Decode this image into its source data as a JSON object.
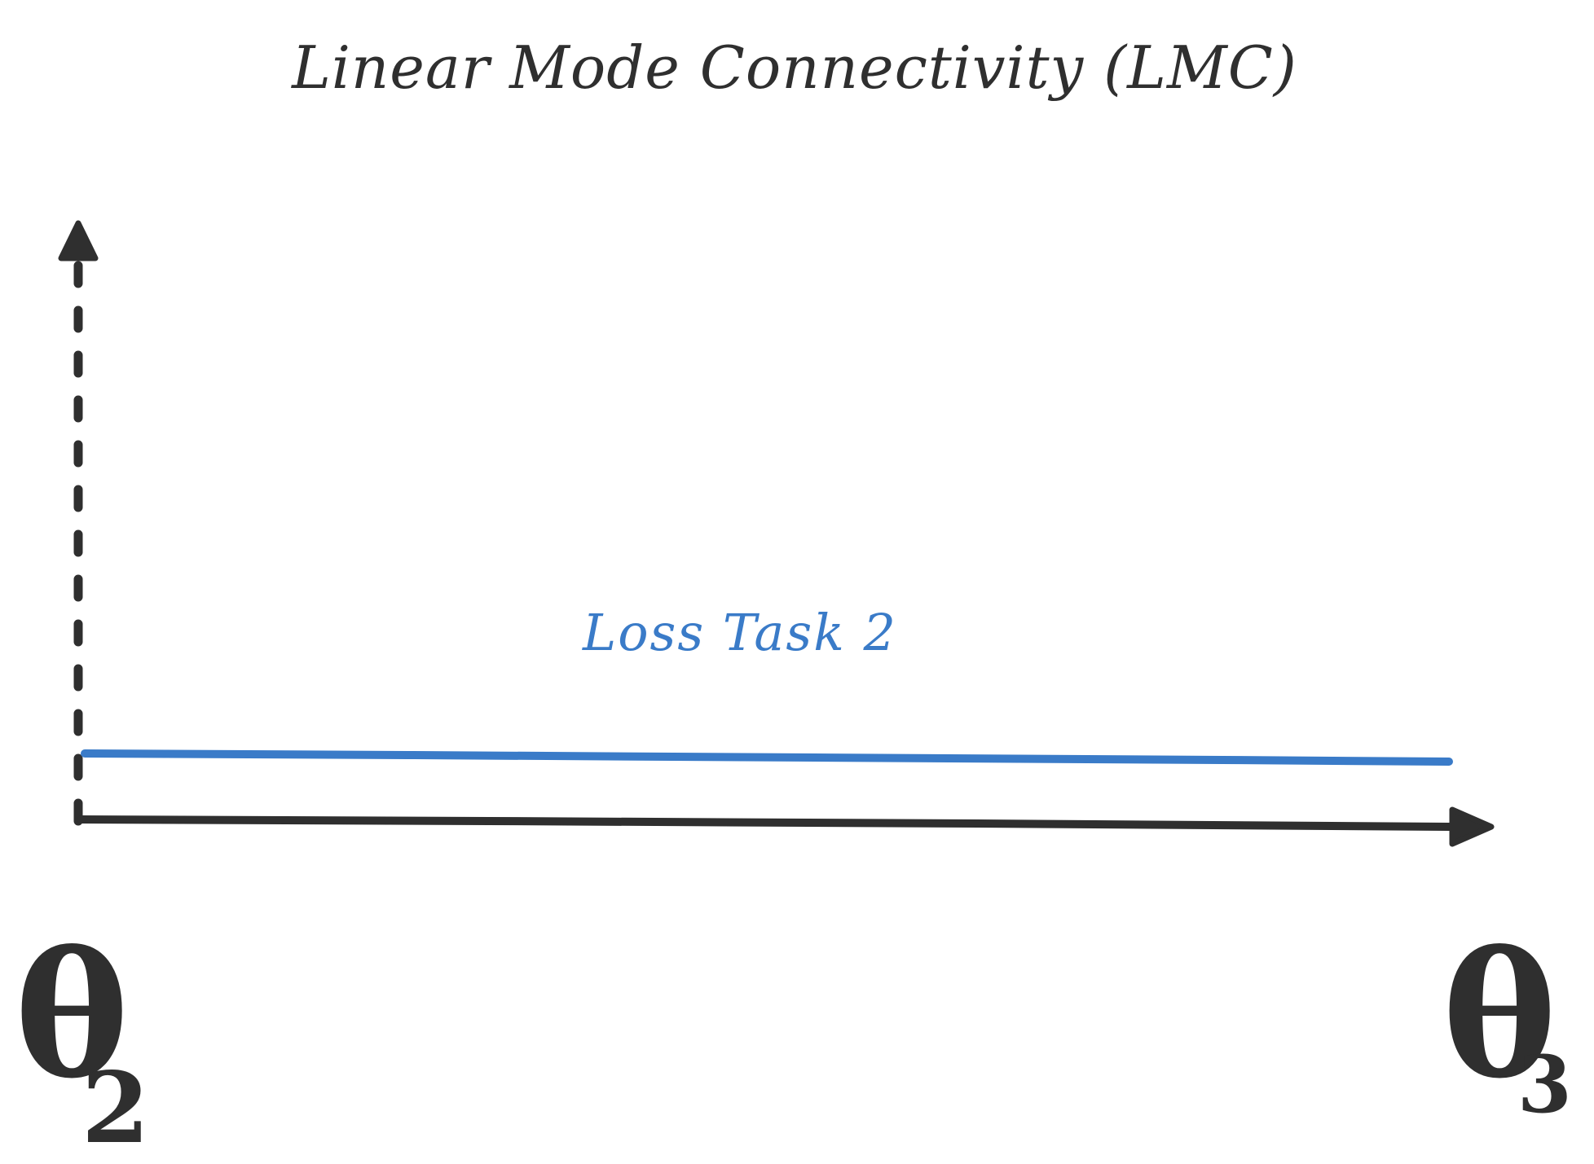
{
  "diagram": {
    "title": "Linear Mode Connectivity (LMC)",
    "curve_label": "Loss Task 2",
    "colors": {
      "ink": "#2f2f2f",
      "loss_line": "#3a7bc8",
      "background": "#ffffff"
    },
    "endpoints": {
      "left": {
        "symbol": "θ",
        "subscript": "2"
      },
      "right": {
        "symbol": "θ",
        "subscript": "3"
      }
    },
    "axes": {
      "vertical": {
        "style": "dashed",
        "arrowhead": "up"
      },
      "horizontal": {
        "style": "solid",
        "arrowhead": "right"
      }
    }
  }
}
